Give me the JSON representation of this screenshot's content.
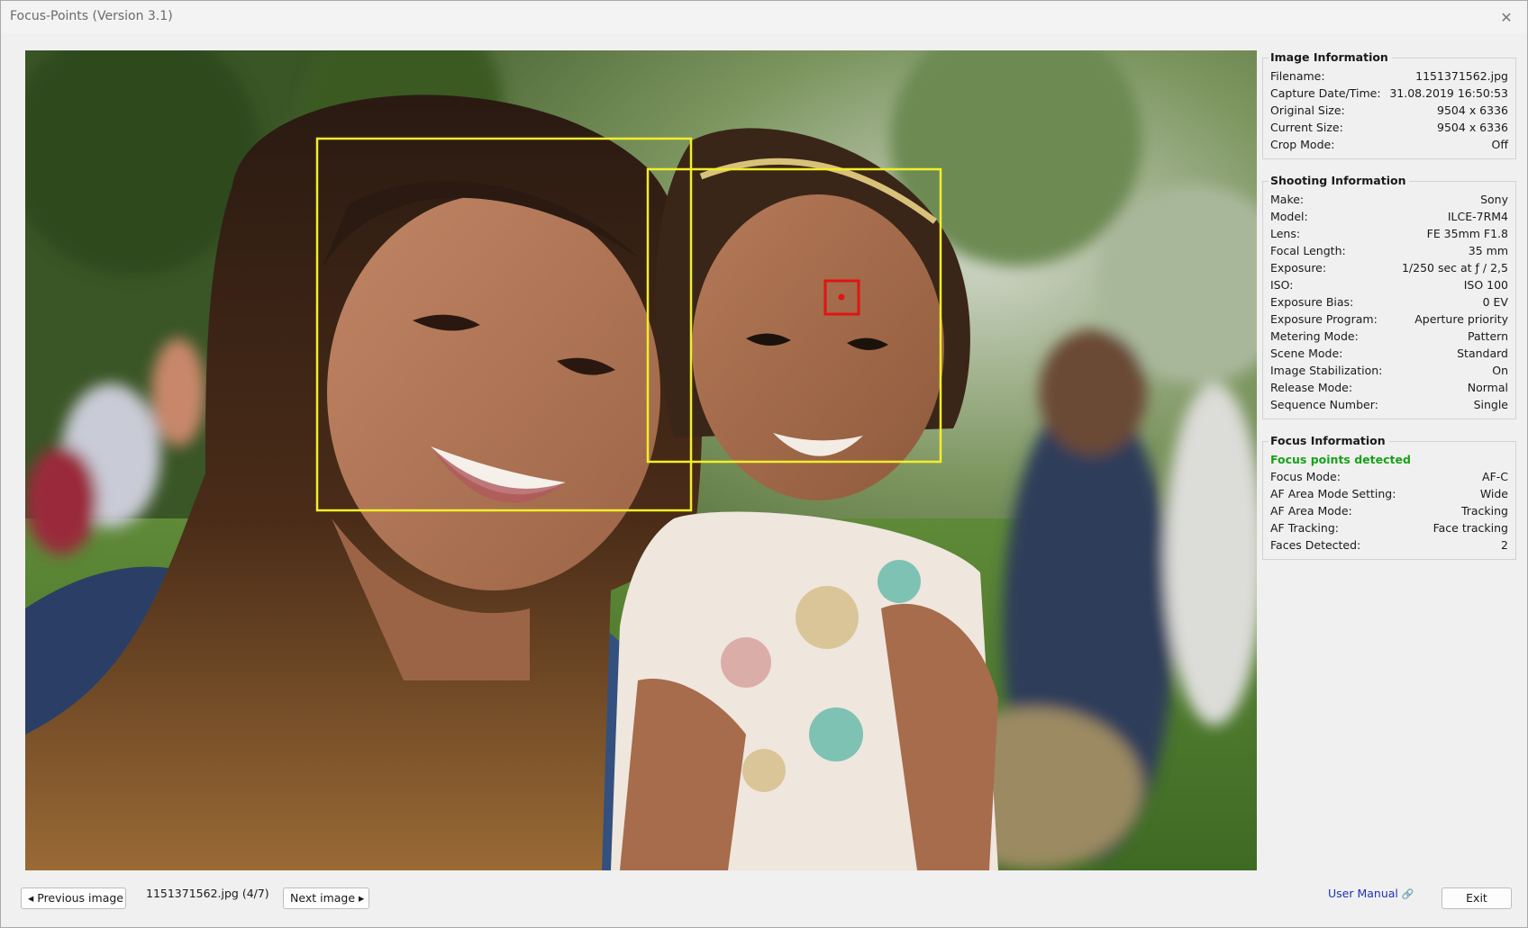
{
  "window": {
    "title": "Focus-Points (Version 3.1)",
    "close_icon": "close-icon"
  },
  "image_info": {
    "heading": "Image Information",
    "rows": [
      {
        "label": "Filename:",
        "value": "1151371562.jpg"
      },
      {
        "label": "Capture Date/Time:",
        "value": "31.08.2019 16:50:53"
      },
      {
        "label": "Original Size:",
        "value": "9504 x 6336"
      },
      {
        "label": "Current Size:",
        "value": "9504 x 6336"
      },
      {
        "label": "Crop Mode:",
        "value": "Off"
      }
    ]
  },
  "shooting_info": {
    "heading": "Shooting Information",
    "rows": [
      {
        "label": "Make:",
        "value": "Sony"
      },
      {
        "label": "Model:",
        "value": "ILCE-7RM4"
      },
      {
        "label": "Lens:",
        "value": "FE 35mm F1.8"
      },
      {
        "label": "Focal Length:",
        "value": "35 mm"
      },
      {
        "label": "Exposure:",
        "value": "1/250 sec at ƒ / 2,5"
      },
      {
        "label": "ISO:",
        "value": "ISO 100"
      },
      {
        "label": "Exposure Bias:",
        "value": "0 EV"
      },
      {
        "label": "Exposure Program:",
        "value": "Aperture priority"
      },
      {
        "label": "Metering Mode:",
        "value": "Pattern"
      },
      {
        "label": "Scene Mode:",
        "value": "Standard"
      },
      {
        "label": "Image Stabilization:",
        "value": "On"
      },
      {
        "label": "Release Mode:",
        "value": "Normal"
      },
      {
        "label": "Sequence Number:",
        "value": "Single"
      }
    ]
  },
  "focus_info": {
    "heading": "Focus Information",
    "status": "Focus points detected",
    "rows": [
      {
        "label": "Focus Mode:",
        "value": "AF-C"
      },
      {
        "label": "AF Area Mode Setting:",
        "value": "Wide"
      },
      {
        "label": "AF Area Mode:",
        "value": "Tracking"
      },
      {
        "label": "AF Tracking:",
        "value": "Face tracking"
      },
      {
        "label": "Faces Detected:",
        "value": "2"
      }
    ]
  },
  "navigation": {
    "previous_label": "◂ Previous image",
    "file_status": "1151371562.jpg (4/7)",
    "next_label": "Next image ▸",
    "manual_label": "User Manual",
    "manual_icon": "external-link-icon",
    "exit_label": "Exit"
  },
  "colors": {
    "face_frame": "#f2ee2a",
    "focus_point": "#e01414",
    "status_ok": "#18a018",
    "link": "#1f32b8"
  }
}
